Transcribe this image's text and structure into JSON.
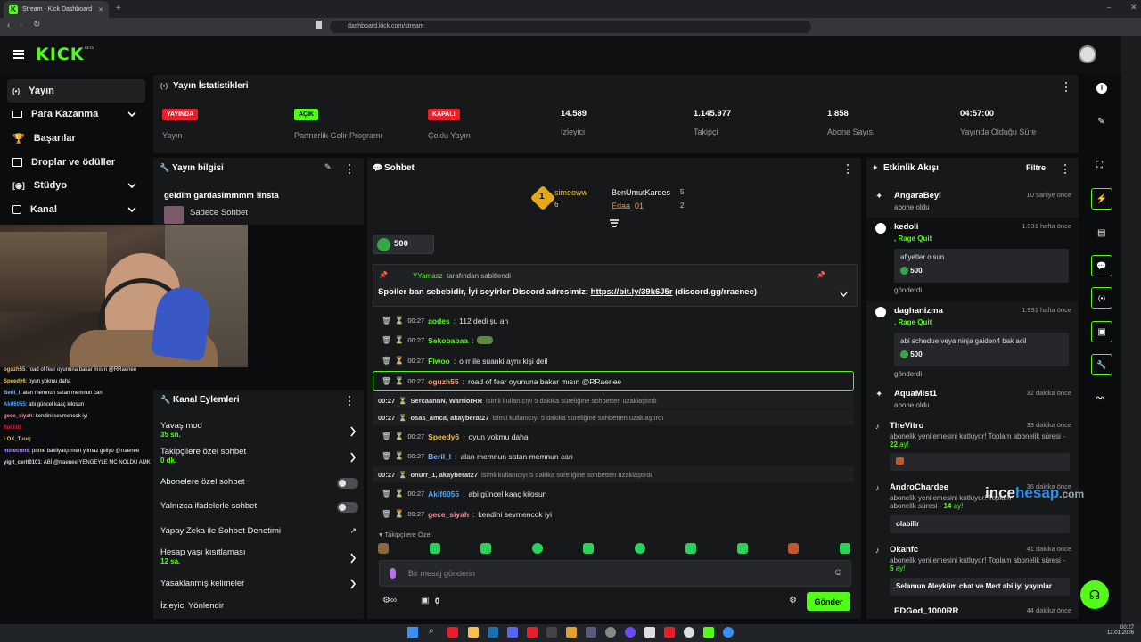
{
  "browser": {
    "tab_title": "Stream - Kick Dashboard",
    "url": "dashboard.kick.com/stream"
  },
  "brand": {
    "logo": "KICK",
    "beta": "BETA",
    "accent": "#53fc18"
  },
  "sidebar": {
    "items": [
      {
        "label": "Yayın",
        "icon": "broadcast-icon"
      },
      {
        "label": "Para Kazanma",
        "icon": "money-icon"
      },
      {
        "label": "Başarılar",
        "icon": "trophy-icon"
      },
      {
        "label": "Droplar ve ödüller",
        "icon": "gift-icon"
      },
      {
        "label": "Stüdyo",
        "icon": "camera-icon"
      },
      {
        "label": "Kanal",
        "icon": "person-icon"
      }
    ]
  },
  "stats": {
    "title": "Yayın İstatistikleri",
    "items": [
      {
        "badge": "YAYINDA",
        "label": "Yayın",
        "color": "#e5202c"
      },
      {
        "badge": "AÇIK",
        "label": "Partnerlik Gelir Programı",
        "color": "#53fc18"
      },
      {
        "badge": "KAPALI",
        "label": "Çoklu Yayın",
        "color": "#e5202c"
      },
      {
        "value": "14.589",
        "label": "İzleyici"
      },
      {
        "value": "1.145.977",
        "label": "Takipçi"
      },
      {
        "value": "1.858",
        "label": "Abone Sayısı"
      },
      {
        "value": "04:57:00",
        "label": "Yayında Olduğu Süre"
      }
    ]
  },
  "stream_info": {
    "title": "Yayın bilgisi",
    "stream_title": "geldim gardasimmmm !insta",
    "category": "Sadece Sohbet"
  },
  "overlay_chat": [
    {
      "user": "oguzh55",
      "text": ": road of fear oyununa bakar mısın @RRaenee"
    },
    {
      "user": "Speedy6",
      "text": ": oyun yokmu daha"
    },
    {
      "user": "Beril_l",
      "text": ": alan memnun satan memnun can"
    },
    {
      "user": "Akif6055",
      "text": ": abi güncel kaaç kilosun"
    },
    {
      "user": "gece_siyah",
      "text": ": kendini sevmencok iyi"
    },
    {
      "user": "flokiiiii",
      "text": ":"
    },
    {
      "user": "LOX_Tuuq",
      "text": ":"
    },
    {
      "user": "minecroni",
      "text": ": prime bakliyatçı mert yılmaz geliyo @rraenee"
    },
    {
      "user": "yigit_cerit0101",
      "text": ": ABİ @rraenee YENGEYLE MC NOLDU AMK"
    }
  ],
  "actions": {
    "title": "Kanal Eylemleri",
    "slow_mode": {
      "label": "Yavaş mod",
      "value": "35 sn."
    },
    "followers_only": {
      "label": "Takipçilere özel sohbet",
      "value": "0 dk."
    },
    "subs_only": {
      "label": "Abonelere özel sohbet"
    },
    "emotes_only": {
      "label": "Yalnızca ifadelerle sohbet"
    },
    "ai_mod": {
      "label": "Yapay Zeka ile Sohbet Denetimi"
    },
    "account_age": {
      "label": "Hesap yaşı kısıtlaması",
      "value": "12 sa."
    },
    "banned_words": {
      "label": "Yasaklanmış kelimeler"
    },
    "redirect": {
      "label": "İzleyici Yönlendir"
    }
  },
  "chat": {
    "title": "Sohbet",
    "leaders": [
      {
        "name": "simeoww",
        "count": "6",
        "rank": "1"
      },
      {
        "name": "BenUmutKardes",
        "count": "5"
      },
      {
        "name": "Edaa_01",
        "count": "2"
      }
    ],
    "kicks": "500",
    "pinned_by_user": "YYamasz",
    "pinned_by_suffix": "tarafından sabitlendi",
    "pinned_text": "Spoiler ban sebebidir, İyi seyirler Discord adresimiz:",
    "pinned_link": "https://bit.ly/39k6J5r",
    "pinned_tail": "(discord.gg/rraenee)",
    "messages": [
      {
        "time": "00:27",
        "user": "aodes",
        "color": "#53fc18",
        "text": "112 dedi şu an"
      },
      {
        "time": "00:27",
        "user": "Sekobabaa",
        "color": "#53fc18",
        "text": ""
      },
      {
        "time": "00:27",
        "user": "Fiwoo",
        "color": "#53fc18",
        "text": "o rr ile suanki aynı kişi deil"
      },
      {
        "time": "00:27",
        "user": "oguzh55",
        "color": "#ff9a6b",
        "text": "road of fear oyununa bakar mısın @RRaenee"
      },
      {
        "time": "00:27",
        "user": "Speedy6",
        "color": "#f2c14e",
        "text": "oyun yokmu daha"
      },
      {
        "time": "00:27",
        "user": "Beril_l",
        "color": "#7ab3ff",
        "text": "alan memnun satan memnun can"
      },
      {
        "time": "00:27",
        "user": "Akif6055",
        "color": "#4aa8ff",
        "text": "abi güncel kaaç kilosun"
      },
      {
        "time": "00:27",
        "user": "gece_siyah",
        "color": "#ff8fa3",
        "text": "kendini sevmencok iyi"
      }
    ],
    "system": [
      {
        "time": "00:27",
        "users": "SercaannN, WarriorRR",
        "text": "isimli kullanıcıyı 5 dakika süreliğine sohbetten uzaklaştırdı"
      },
      {
        "time": "00:27",
        "users": "osas_amca, akayberat27",
        "text": "isimli kullanıcıyı 5 dakika süreliğine sohbetten uzaklaştırdı"
      },
      {
        "time": "00:27",
        "users": "onurr_1, akayberat27",
        "text": "isimli kullanıcıyı 5 dakika süreliğine sohbetten uzaklaştırdı"
      }
    ],
    "followers_only_label": "Takipçilere Özel",
    "input_placeholder": "Bir mesaj gönderin",
    "send_label": "Gönder",
    "gift_count": "0"
  },
  "activity": {
    "title": "Etkinlik Akışı",
    "filter_label": "Filtre",
    "events": [
      {
        "name": "AngaraBeyi",
        "time": "10 saniye önce",
        "sub": "abone oldu"
      },
      {
        "name": "kedoli",
        "time": "1.931 hafta önce",
        "sub": ", Rage Quit",
        "box": "afiyetler olsun",
        "kicks": "500",
        "status": "gönderdi"
      },
      {
        "name": "daghanizma",
        "time": "1.931 hafta önce",
        "sub": ", Rage Quit",
        "box": "abi schedue veya ninja gaiden4 bak acil",
        "kicks": "500",
        "status": "gönderdi"
      },
      {
        "name": "AquaMist1",
        "time": "32 dakika önce",
        "sub": "abone oldu"
      },
      {
        "name": "TheVitro",
        "time": "33 dakika önce",
        "sub": "abonelik yenilemesini kutluyor! Toplam abonelik süresi -",
        "months": "22",
        "unit": "ay!"
      },
      {
        "name": "AndroChardee",
        "time": "36 dakika önce",
        "sub": "abonelik yenilemesini kutluyor! Toplam abonelik süresi -",
        "months": "14",
        "unit": "ay!",
        "box": "olabilir"
      },
      {
        "name": "Okanfc",
        "time": "41 dakika önce",
        "sub": "abonelik yenilemesini kutluyor! Toplam abonelik süresi -",
        "months": "5",
        "unit": "ay!",
        "box": "Selamun Aleyküm chat ve Mert abi iyi yayınlar"
      },
      {
        "name": "EDGod_1000RR",
        "time": "44 dakika önce"
      }
    ]
  },
  "watermark": {
    "a": "ince",
    "b": "hesap",
    "c": ".com"
  },
  "clock": {
    "time": "00:27",
    "date": "12.01.2026"
  }
}
